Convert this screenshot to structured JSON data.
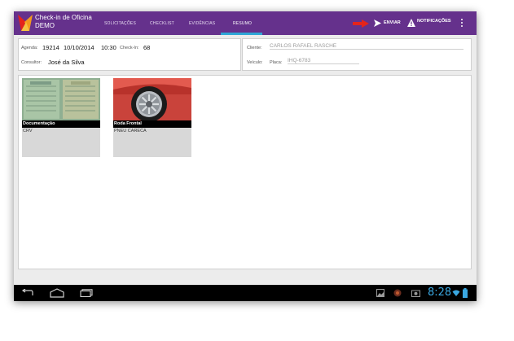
{
  "app": {
    "title_line1": "Check-in de Oficina",
    "title_line2": "DEMO"
  },
  "tabs": [
    {
      "label": "SOLICITAÇÕES"
    },
    {
      "label": "CHECKLIST"
    },
    {
      "label": "EVIDÊNCIAS"
    },
    {
      "label": "RESUMO",
      "active": true
    }
  ],
  "actions": {
    "send_label": "ENVIAR",
    "notifications_label": "NOTIFICAÇÕES"
  },
  "summary": {
    "agenda_label": "Agenda:",
    "agenda_number": "19214",
    "date": "10/10/2014",
    "time": "10:30",
    "checkin_label": "Check-In:",
    "checkin_value": "68",
    "consultor_label": "Consultor:",
    "consultor_value": "José da Silva",
    "cliente_label": "Cliente:",
    "cliente_value": "CARLOS RAFAEL RASCHE",
    "veiculo_label": "Veículo:",
    "placa_label": "Placa:",
    "placa_value": "IHQ-6783"
  },
  "evidences": [
    {
      "title": "Documentação",
      "subtitle": "CRV",
      "icon": "document-photo"
    },
    {
      "title": "Roda Frontal",
      "subtitle": "PNEU CARECA",
      "icon": "wheel-photo"
    }
  ],
  "system": {
    "clock": "8:28"
  },
  "colors": {
    "appbar": "#65318c",
    "accent": "#2fa6d6",
    "arrow": "#e5241b"
  }
}
